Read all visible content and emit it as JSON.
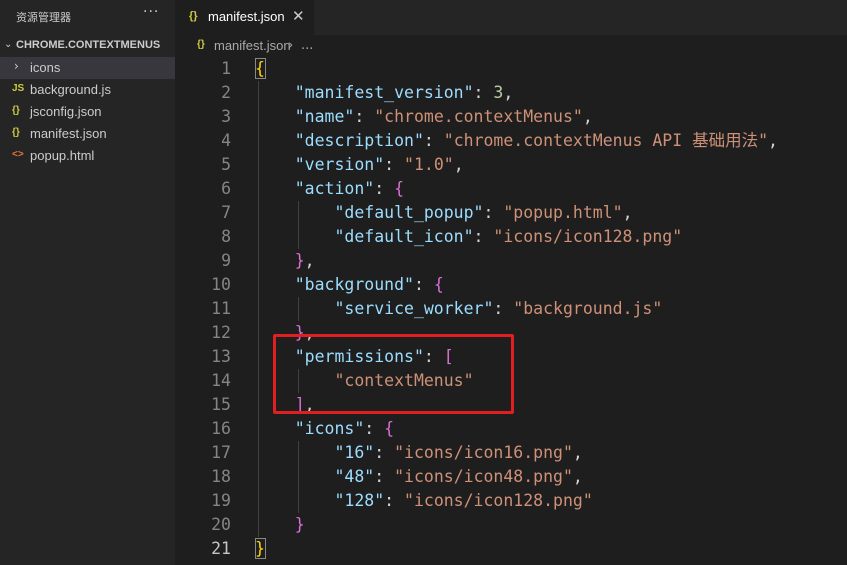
{
  "explorer": {
    "title": "资源管理器",
    "more": "···",
    "folder": "CHROME.CONTEXTMENUS",
    "items": [
      {
        "icon": "›",
        "name": "icons",
        "type": "folder"
      },
      {
        "icon": "JS",
        "name": "background.js",
        "type": "js"
      },
      {
        "icon": "{}",
        "name": "jsconfig.json",
        "type": "json"
      },
      {
        "icon": "{}",
        "name": "manifest.json",
        "type": "json"
      },
      {
        "icon": "<>",
        "name": "popup.html",
        "type": "html"
      }
    ]
  },
  "tab": {
    "icon": "{}",
    "label": "manifest.json",
    "close": "✕"
  },
  "breadcrumb": {
    "icon": "{}",
    "file": "manifest.json",
    "sep": "›",
    "more": "..."
  },
  "editor": {
    "line_numbers": [
      "1",
      "2",
      "3",
      "4",
      "5",
      "6",
      "7",
      "8",
      "9",
      "10",
      "11",
      "12",
      "13",
      "14",
      "15",
      "16",
      "17",
      "18",
      "19",
      "20",
      "21"
    ],
    "active_line": "21",
    "lines": [
      [
        {
          "t": "{",
          "c": "b1"
        }
      ],
      [
        {
          "t": "    \"manifest_version\"",
          "c": "k"
        },
        {
          "t": ": ",
          "c": "p"
        },
        {
          "t": "3",
          "c": "n"
        },
        {
          "t": ",",
          "c": "p"
        }
      ],
      [
        {
          "t": "    \"name\"",
          "c": "k"
        },
        {
          "t": ": ",
          "c": "p"
        },
        {
          "t": "\"chrome.contextMenus\"",
          "c": "s"
        },
        {
          "t": ",",
          "c": "p"
        }
      ],
      [
        {
          "t": "    \"description\"",
          "c": "k"
        },
        {
          "t": ": ",
          "c": "p"
        },
        {
          "t": "\"chrome.contextMenus API 基础用法\"",
          "c": "s"
        },
        {
          "t": ",",
          "c": "p"
        }
      ],
      [
        {
          "t": "    \"version\"",
          "c": "k"
        },
        {
          "t": ": ",
          "c": "p"
        },
        {
          "t": "\"1.0\"",
          "c": "s"
        },
        {
          "t": ",",
          "c": "p"
        }
      ],
      [
        {
          "t": "    \"action\"",
          "c": "k"
        },
        {
          "t": ": ",
          "c": "p"
        },
        {
          "t": "{",
          "c": "b2"
        }
      ],
      [
        {
          "t": "        \"default_popup\"",
          "c": "k"
        },
        {
          "t": ": ",
          "c": "p"
        },
        {
          "t": "\"popup.html\"",
          "c": "s"
        },
        {
          "t": ",",
          "c": "p"
        }
      ],
      [
        {
          "t": "        \"default_icon\"",
          "c": "k"
        },
        {
          "t": ": ",
          "c": "p"
        },
        {
          "t": "\"icons/icon128.png\"",
          "c": "s"
        }
      ],
      [
        {
          "t": "    }",
          "c": "b2"
        },
        {
          "t": ",",
          "c": "p"
        }
      ],
      [
        {
          "t": "    \"background\"",
          "c": "k"
        },
        {
          "t": ": ",
          "c": "p"
        },
        {
          "t": "{",
          "c": "b2"
        }
      ],
      [
        {
          "t": "        \"service_worker\"",
          "c": "k"
        },
        {
          "t": ": ",
          "c": "p"
        },
        {
          "t": "\"background.js\"",
          "c": "s"
        }
      ],
      [
        {
          "t": "    }",
          "c": "b2"
        },
        {
          "t": ",",
          "c": "p"
        }
      ],
      [
        {
          "t": "    \"permissions\"",
          "c": "k"
        },
        {
          "t": ": ",
          "c": "p"
        },
        {
          "t": "[",
          "c": "b2"
        }
      ],
      [
        {
          "t": "        \"contextMenus\"",
          "c": "s"
        }
      ],
      [
        {
          "t": "    ]",
          "c": "b2"
        },
        {
          "t": ",",
          "c": "p"
        }
      ],
      [
        {
          "t": "    \"icons\"",
          "c": "k"
        },
        {
          "t": ": ",
          "c": "p"
        },
        {
          "t": "{",
          "c": "b2"
        }
      ],
      [
        {
          "t": "        \"16\"",
          "c": "k"
        },
        {
          "t": ": ",
          "c": "p"
        },
        {
          "t": "\"icons/icon16.png\"",
          "c": "s"
        },
        {
          "t": ",",
          "c": "p"
        }
      ],
      [
        {
          "t": "        \"48\"",
          "c": "k"
        },
        {
          "t": ": ",
          "c": "p"
        },
        {
          "t": "\"icons/icon48.png\"",
          "c": "s"
        },
        {
          "t": ",",
          "c": "p"
        }
      ],
      [
        {
          "t": "        \"128\"",
          "c": "k"
        },
        {
          "t": ": ",
          "c": "p"
        },
        {
          "t": "\"icons/icon128.png\"",
          "c": "s"
        }
      ],
      [
        {
          "t": "    }",
          "c": "b2"
        }
      ],
      [
        {
          "t": "}",
          "c": "b1"
        }
      ]
    ]
  },
  "colors": {
    "annotation_box": "#e02020",
    "json_icon": "#cbcb41",
    "js_icon": "#cbcb41",
    "html_icon": "#e37933"
  }
}
